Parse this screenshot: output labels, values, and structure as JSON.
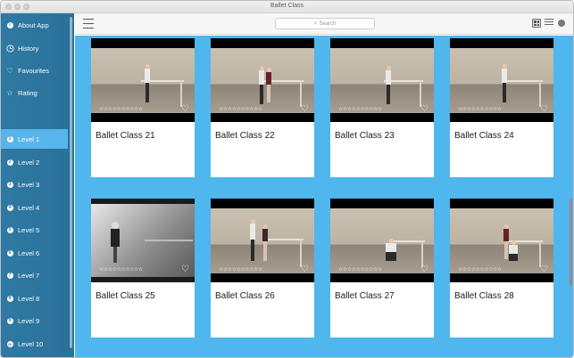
{
  "window": {
    "title": "Ballet Class"
  },
  "toolbar": {
    "search_placeholder": "Search"
  },
  "sidebar": {
    "top_items": [
      {
        "label": "About App",
        "icon": "info-icon"
      },
      {
        "label": "History",
        "icon": "clock-icon"
      },
      {
        "label": "Favourites",
        "icon": "heart-icon"
      },
      {
        "label": "Rating",
        "icon": "star-icon"
      }
    ],
    "levels": [
      {
        "label": "Level 1",
        "num": "1",
        "active": true
      },
      {
        "label": "Level 2",
        "num": "2"
      },
      {
        "label": "Level 3",
        "num": "3"
      },
      {
        "label": "Level 4",
        "num": "4"
      },
      {
        "label": "Level 5",
        "num": "5"
      },
      {
        "label": "Level 6",
        "num": "6"
      },
      {
        "label": "Level 7",
        "num": "7"
      },
      {
        "label": "Level 8",
        "num": "8"
      },
      {
        "label": "Level 9",
        "num": "9"
      },
      {
        "label": "Level 10",
        "num": "10"
      }
    ]
  },
  "cards": [
    {
      "title": "Ballet Class 21",
      "stars": "☆☆☆☆☆☆☆☆☆☆"
    },
    {
      "title": "Ballet Class 22",
      "stars": "☆☆☆☆☆☆☆☆☆☆"
    },
    {
      "title": "Ballet Class 23",
      "stars": "☆☆☆☆☆☆☆☆☆☆"
    },
    {
      "title": "Ballet Class 24",
      "stars": "☆☆☆☆☆☆☆☆☆☆"
    },
    {
      "title": "Ballet Class 25",
      "stars": "☆☆☆☆☆☆☆☆☆☆"
    },
    {
      "title": "Ballet Class 26",
      "stars": "☆☆☆☆☆☆☆☆☆☆"
    },
    {
      "title": "Ballet Class 27",
      "stars": "☆☆☆☆☆☆☆☆☆☆"
    },
    {
      "title": "Ballet Class 28",
      "stars": "☆☆☆☆☆☆☆☆☆☆"
    }
  ],
  "colors": {
    "sidebar": "#2e79a3",
    "active_item": "#58b5ec",
    "content_bg": "#4fb6ee"
  }
}
